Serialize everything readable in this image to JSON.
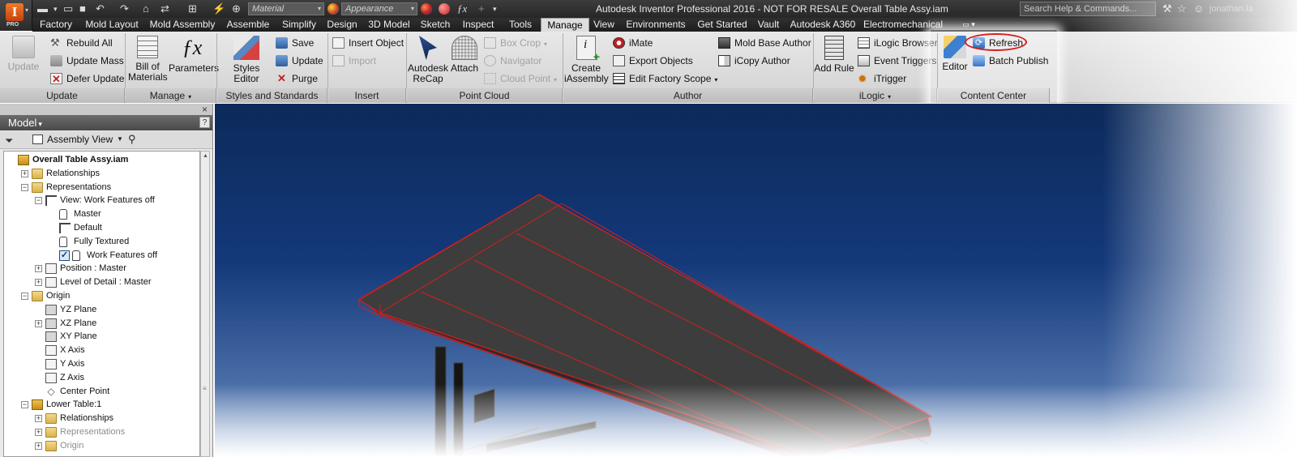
{
  "titlebar": {
    "material_placeholder": "Material",
    "appearance_placeholder": "Appearance",
    "window_title": "Autodesk Inventor Professional 2016 - NOT FOR RESALE    Overall Table Assy.iam",
    "search_placeholder": "Search Help & Commands...",
    "user_name": "jonathan.la",
    "app_badge": "PRO",
    "app_letter": "I"
  },
  "menu": {
    "tabs": [
      "Factory",
      "Mold Layout",
      "Mold Assembly",
      "Assemble",
      "Simplify",
      "Design",
      "3D Model",
      "Sketch",
      "Inspect",
      "Tools",
      "Manage",
      "View",
      "Environments",
      "Get Started",
      "Vault",
      "Autodesk A360",
      "Electromechanical"
    ],
    "active_tab": "Manage"
  },
  "ribbon": {
    "update": {
      "big": "Update",
      "rebuild_all": "Rebuild All",
      "update_mass": "Update Mass",
      "defer_update": "Defer Update",
      "panel": "Update"
    },
    "manage": {
      "bom_line1": "Bill of",
      "bom_line2": "Materials",
      "parameters": "Parameters",
      "panel": "Manage"
    },
    "styles": {
      "styles_editor": "Styles Editor",
      "save": "Save",
      "update": "Update",
      "purge": "Purge",
      "panel": "Styles and Standards"
    },
    "insert": {
      "insert_object": "Insert Object",
      "import": "Import",
      "panel": "Insert"
    },
    "point_cloud": {
      "recap_line1": "Autodesk",
      "recap_line2": "ReCap",
      "attach": "Attach",
      "box_crop": "Box Crop",
      "navigator": "Navigator",
      "cloud_point": "Cloud Point",
      "panel": "Point Cloud"
    },
    "author": {
      "create_line1": "Create",
      "create_line2": "iAssembly",
      "imate": "iMate",
      "export_objects": "Export Objects",
      "edit_factory_scope": "Edit Factory Scope",
      "mold_base_author": "Mold Base Author",
      "icopy_author": "iCopy Author",
      "panel": "Author"
    },
    "ilogic": {
      "add_rule": "Add Rule",
      "ilogic_browser": "iLogic Browser",
      "event_triggers": "Event Triggers",
      "itrigger": "iTrigger",
      "panel": "iLogic"
    },
    "content_center": {
      "editor": "Editor",
      "refresh": "Refresh",
      "batch_publish": "Batch Publish",
      "panel": "Content Center"
    }
  },
  "browser": {
    "header": "Model",
    "view_combo": "Assembly View",
    "tree": [
      {
        "label": "Overall Table Assy.iam",
        "indent": 0,
        "icon": "assembly-icon",
        "expander": "",
        "root": true
      },
      {
        "label": "Relationships",
        "indent": 1,
        "icon": "folder-icon",
        "expander": "+"
      },
      {
        "label": "Representations",
        "indent": 1,
        "icon": "representations-icon",
        "expander": "-"
      },
      {
        "label": "View: Work Features off",
        "indent": 2,
        "icon": "view-rep-icon",
        "expander": "-"
      },
      {
        "label": "Master",
        "indent": 3,
        "icon": "lock-icon",
        "expander": ""
      },
      {
        "label": "Default",
        "indent": 3,
        "icon": "view-rep-icon",
        "expander": ""
      },
      {
        "label": "Fully Textured",
        "indent": 3,
        "icon": "lock-icon",
        "expander": ""
      },
      {
        "label": "Work Features off",
        "indent": 3,
        "icon": "lock-icon",
        "expander": "",
        "checked": true
      },
      {
        "label": "Position : Master",
        "indent": 2,
        "icon": "position-icon",
        "expander": "+"
      },
      {
        "label": "Level of Detail : Master",
        "indent": 2,
        "icon": "lod-icon",
        "expander": "+"
      },
      {
        "label": "Origin",
        "indent": 1,
        "icon": "folder-icon",
        "expander": "-"
      },
      {
        "label": "YZ Plane",
        "indent": 2,
        "icon": "plane-icon",
        "expander": ""
      },
      {
        "label": "XZ Plane",
        "indent": 2,
        "icon": "plane-icon",
        "expander": "+"
      },
      {
        "label": "XY Plane",
        "indent": 2,
        "icon": "plane-icon",
        "expander": ""
      },
      {
        "label": "X Axis",
        "indent": 2,
        "icon": "axis-icon",
        "expander": ""
      },
      {
        "label": "Y Axis",
        "indent": 2,
        "icon": "axis-icon",
        "expander": ""
      },
      {
        "label": "Z Axis",
        "indent": 2,
        "icon": "axis-icon",
        "expander": ""
      },
      {
        "label": "Center Point",
        "indent": 2,
        "icon": "point-icon",
        "expander": ""
      },
      {
        "label": "Lower Table:1",
        "indent": 1,
        "icon": "assembly-icon",
        "expander": "-"
      },
      {
        "label": "Relationships",
        "indent": 2,
        "icon": "folder-icon",
        "expander": "+"
      },
      {
        "label": "Representations",
        "indent": 2,
        "icon": "representations-icon",
        "expander": "+",
        "dim": true
      },
      {
        "label": "Origin",
        "indent": 2,
        "icon": "folder-icon",
        "expander": "+",
        "dim": true
      }
    ]
  },
  "colors": {
    "accent_highlight": "#d41d1d",
    "viewport_top": "#0c2a5a",
    "part_edge": "#d0201c",
    "part_face": "#3d3d3d"
  }
}
